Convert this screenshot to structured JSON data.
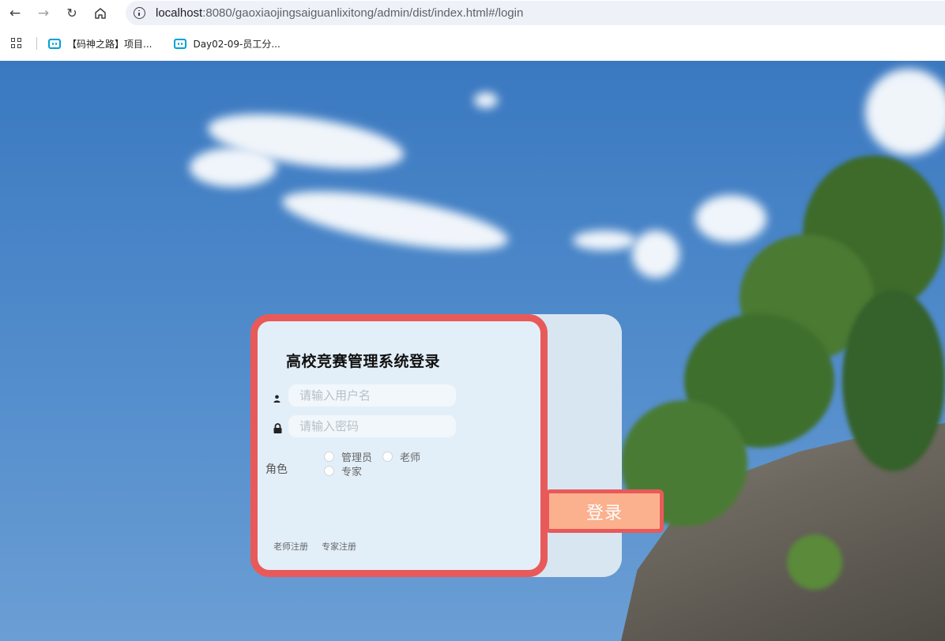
{
  "browser": {
    "url_host": "localhost",
    "url_rest": ":8080/gaoxiaojingsaiguanlixitong/admin/dist/index.html#/login",
    "bookmarks": [
      {
        "label": "【码神之路】项目..."
      },
      {
        "label": "Day02-09-员工分..."
      }
    ]
  },
  "login": {
    "title": "高校竞赛管理系统登录",
    "username_placeholder": "请输入用户名",
    "password_placeholder": "请输入密码",
    "role_label": "角色",
    "roles": [
      "管理员",
      "老师",
      "专家"
    ],
    "register_links": [
      "老师注册",
      "专家注册"
    ],
    "submit_label": "登录"
  },
  "colors": {
    "card_border": "#e85a5a",
    "button_fill": "#fbb08e",
    "card_bg": "#e3eff8"
  }
}
